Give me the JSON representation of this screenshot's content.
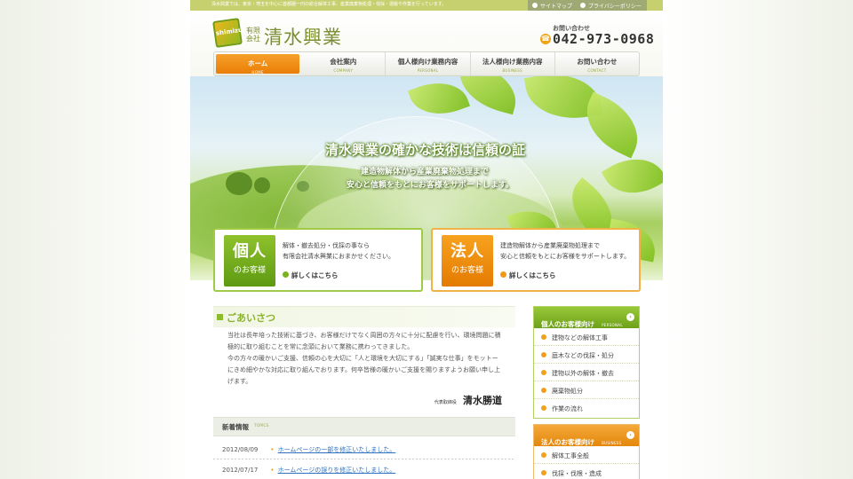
{
  "topbar": {
    "tagline": "清水興業では、東京・埼玉を中心に首都圏一円の総合解体工事、産業廃棄物処理・伐採・運搬や作業を行っています。",
    "links": [
      {
        "label": "サイトマップ"
      },
      {
        "label": "プライバシーポリシー"
      }
    ]
  },
  "header": {
    "logo_mark": "shimizu",
    "logo_small": "有限会社",
    "company_name": "清水興業",
    "contact_label": "お問い合わせ",
    "phone_icon": "phone-icon",
    "phone": "042-973-0968"
  },
  "nav": {
    "items": [
      {
        "label": "ホーム",
        "sub": "HOME",
        "active": true
      },
      {
        "label": "会社案内",
        "sub": "COMPANY",
        "active": false
      },
      {
        "label": "個人様向け業務内容",
        "sub": "PERSONAL",
        "active": false
      },
      {
        "label": "法人様向け業務内容",
        "sub": "BUSINESS",
        "active": false
      },
      {
        "label": "お問い合わせ",
        "sub": "CONTACT",
        "active": false
      }
    ]
  },
  "hero": {
    "title": "清水興業の確かな技術は信頼の証",
    "line1": "建造物解体から産業廃棄物処理まで",
    "line2": "安心と信頼をもとにお客様をサポートします。"
  },
  "services": {
    "personal": {
      "badge_big": "個人",
      "badge_small": "のお客様",
      "text1": "解体・撤去処分・伐採の事なら",
      "text2": "有限会社清水興業におまかせください。",
      "link": "詳しくはこちら"
    },
    "business": {
      "badge_big": "法人",
      "badge_small": "のお客様",
      "text1": "建造物解体から産業廃棄物処理まで",
      "text2": "安心と信頼をもとにお客様をサポートします。",
      "link": "詳しくはこちら"
    }
  },
  "greeting": {
    "title": "ごあいさつ",
    "lines": [
      "当社は長年培った技術に基づき、お客様だけでなく周囲の方々に十分に配慮を行い、環境問題に積",
      "極的に取り組むことを常に念頭において業務に携わってきました。",
      "今の方々の暖かいご支援、信頼の心を大切に「人と環境を大切にする」「誠実な仕事」をモットー",
      "にきめ細やかな対応に取り組んでおります。何卒皆様の暖かいご支援を賜りますようお願い申し上",
      "げます。"
    ],
    "signature_role": "代表取締役",
    "signature_name": "清水勝道"
  },
  "topics": {
    "title": "新着情報",
    "sub": "TOPICS",
    "items": [
      {
        "date": "2012/08/09",
        "text": "ホームページの一部を修正いたしました。"
      },
      {
        "date": "2012/07/17",
        "text": "ホームページの誤りを修正いたしました。"
      }
    ]
  },
  "sidebar": {
    "personal": {
      "title": "個人のお客様向け",
      "sub": "PERSONAL",
      "items": [
        "建物などの解体工事",
        "庭木などの伐採・処分",
        "建物以外の解体・撤去",
        "廃棄物処分",
        "作業の流れ"
      ]
    },
    "business": {
      "title": "法人のお客様向け",
      "sub": "BUSINESS",
      "items": [
        "解体工事全般",
        "伐採・伐根・造成"
      ]
    }
  },
  "colors": {
    "accent_green": "#8cbb2b",
    "accent_orange": "#ee8a0b",
    "link_blue": "#2f72c4"
  }
}
